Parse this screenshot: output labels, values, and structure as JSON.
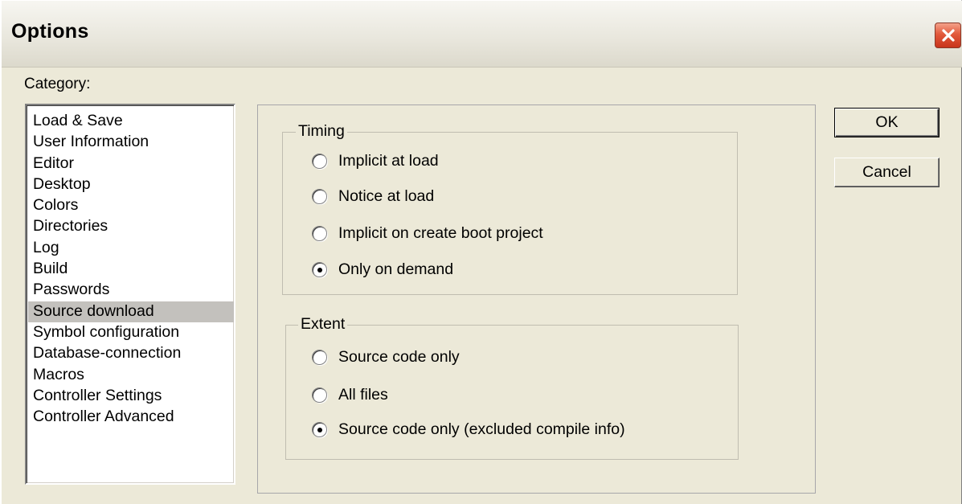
{
  "window": {
    "title": "Options",
    "close_icon": "close-icon",
    "close_color": "#e2593b"
  },
  "category": {
    "label": "Category:",
    "items": [
      {
        "label": "Load & Save"
      },
      {
        "label": "User Information"
      },
      {
        "label": "Editor"
      },
      {
        "label": "Desktop"
      },
      {
        "label": "Colors"
      },
      {
        "label": "Directories"
      },
      {
        "label": "Log"
      },
      {
        "label": "Build"
      },
      {
        "label": "Passwords"
      },
      {
        "label": "Source download",
        "selected": true
      },
      {
        "label": "Symbol configuration"
      },
      {
        "label": "Database-connection"
      },
      {
        "label": "Macros"
      },
      {
        "label": "Controller Settings"
      },
      {
        "label": "Controller Advanced"
      }
    ]
  },
  "timing": {
    "legend": "Timing",
    "options": [
      {
        "label": "Implicit at load",
        "checked": false
      },
      {
        "label": "Notice at load",
        "checked": false
      },
      {
        "label": "Implicit on create boot project",
        "checked": false
      },
      {
        "label": "Only on demand",
        "checked": true
      }
    ]
  },
  "extent": {
    "legend": "Extent",
    "options": [
      {
        "label": "Source code only",
        "checked": false
      },
      {
        "label": "All files",
        "checked": false
      },
      {
        "label": "Source code only (excluded compile info)",
        "checked": true
      }
    ]
  },
  "buttons": {
    "ok": "OK",
    "cancel": "Cancel"
  }
}
